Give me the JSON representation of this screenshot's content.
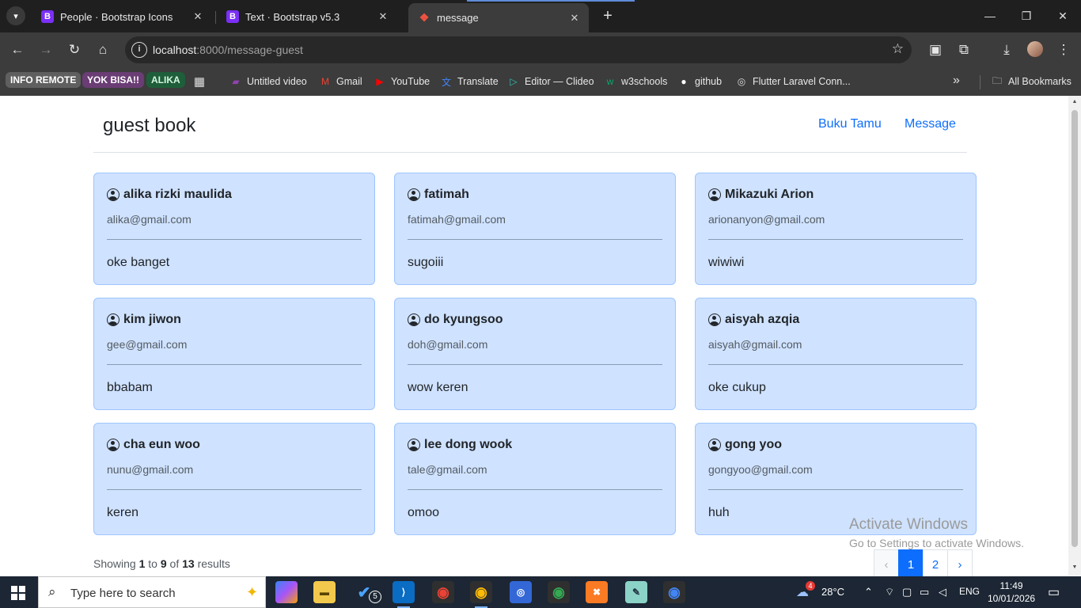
{
  "browser": {
    "tabs": [
      {
        "title": "People · Bootstrap Icons",
        "favicon": "B"
      },
      {
        "title": "Text · Bootstrap v5.3",
        "favicon": "B"
      },
      {
        "title": "message",
        "favicon": "laravel"
      }
    ],
    "close_glyph": "✕",
    "new_tab_glyph": "+",
    "url_host": "localhost",
    "url_path": ":8000/message-guest",
    "bookmarks": {
      "badges": [
        {
          "label": "INFO REMOTE",
          "bg": "#5f5f5f",
          "fg": "#ffffff"
        },
        {
          "label": "YOK BISA!!",
          "bg": "#6a3d74",
          "fg": "#ffffff"
        },
        {
          "label": "ALIKA",
          "bg": "#1e5e3a",
          "fg": "#d4f5de"
        }
      ],
      "items": [
        {
          "label": "Untitled video",
          "icon": "clip-icon",
          "color": "#8e44ad"
        },
        {
          "label": "Gmail",
          "icon": "gmail-icon",
          "color": "#ea4335"
        },
        {
          "label": "YouTube",
          "icon": "youtube-icon",
          "color": "#ff0000"
        },
        {
          "label": "Translate",
          "icon": "translate-icon",
          "color": "#4285f4"
        },
        {
          "label": "Editor — Clideo",
          "icon": "clideo-icon",
          "color": "#2ec4b6"
        },
        {
          "label": "w3schools",
          "icon": "w3schools-icon",
          "color": "#04aa6d"
        },
        {
          "label": "github",
          "icon": "github-icon",
          "color": "#ffffff"
        },
        {
          "label": "Flutter Laravel Conn...",
          "icon": "globe-icon",
          "color": "#dddddd"
        }
      ],
      "all_bookmarks": "All Bookmarks"
    }
  },
  "site": {
    "brand": "guest book",
    "nav": [
      "Buku Tamu",
      "Message"
    ]
  },
  "messages": [
    {
      "name": "alika rizki maulida",
      "email": "alika@gmail.com",
      "message": "oke banget"
    },
    {
      "name": "fatimah",
      "email": "fatimah@gmail.com",
      "message": "sugoiii"
    },
    {
      "name": "Mikazuki Arion",
      "email": "arionanyon@gmail.com",
      "message": "wiwiwi"
    },
    {
      "name": "kim jiwon",
      "email": "gee@gmail.com",
      "message": "bbabam"
    },
    {
      "name": "do kyungsoo",
      "email": "doh@gmail.com",
      "message": "wow keren"
    },
    {
      "name": "aisyah azqia",
      "email": "aisyah@gmail.com",
      "message": "oke cukup"
    },
    {
      "name": "cha eun woo",
      "email": "nunu@gmail.com",
      "message": "keren"
    },
    {
      "name": "lee dong wook",
      "email": "tale@gmail.com",
      "message": "omoo"
    },
    {
      "name": "gong yoo",
      "email": "gongyoo@gmail.com",
      "message": "huh"
    }
  ],
  "results": {
    "prefix": "Showing",
    "from": "1",
    "to_word": "to",
    "to": "9",
    "of_word": "of",
    "total": "13",
    "suffix": "results"
  },
  "pagination": {
    "prev": "‹",
    "pages": [
      "1",
      "2"
    ],
    "current": "1",
    "next": "›"
  },
  "activation": {
    "title": "Activate Windows",
    "subtitle": "Go to Settings to activate Windows."
  },
  "taskbar": {
    "search_placeholder": "Type here to search",
    "weather_temp": "28°C",
    "weather_badge": "4",
    "language": "ENG",
    "time": "11:49",
    "date": "10/01/2026",
    "vs_badge": "5"
  },
  "colors": {
    "card_bg": "#cfe2ff",
    "card_border": "#9ec5fe",
    "link": "#0d6efd",
    "active_page": "#0d6efd"
  }
}
